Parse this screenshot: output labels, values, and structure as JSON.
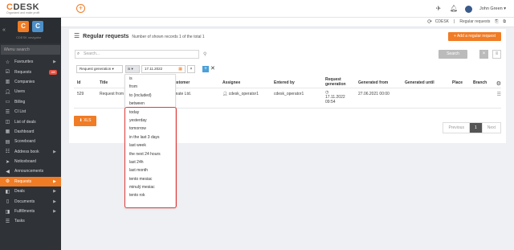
{
  "topbar": {
    "brand_c": "C",
    "brand_rest": "DESK",
    "tagline": "Organized and make profit",
    "add_symbol": "+",
    "user_name": "John Green"
  },
  "sidebar": {
    "logo1": "C",
    "logo2": "C",
    "sub": "CDESK navigator",
    "search_placeholder": "Menu search",
    "items": [
      {
        "label": "Favourites",
        "icon": "star-icon",
        "arrow": true
      },
      {
        "label": "Requests",
        "icon": "checkbox-icon",
        "badge": "169"
      },
      {
        "label": "Companies",
        "icon": "building-icon"
      },
      {
        "label": "Users",
        "icon": "user-icon"
      },
      {
        "label": "Billing",
        "icon": "card-icon"
      },
      {
        "label": "CI List",
        "icon": "list-icon"
      },
      {
        "label": "List of deals",
        "icon": "deal-icon"
      },
      {
        "label": "Dashboard",
        "icon": "dashboard-icon"
      },
      {
        "label": "Scoreboard",
        "icon": "chart-icon"
      },
      {
        "label": "Address book",
        "icon": "address-book-icon",
        "arrow": true
      },
      {
        "label": "Noticeboard",
        "icon": "pin-icon"
      },
      {
        "label": "Announcements",
        "icon": "megaphone-icon"
      },
      {
        "label": "Requests",
        "icon": "requests-icon",
        "arrow": true,
        "active": true
      },
      {
        "label": "Deals",
        "icon": "deals-icon",
        "arrow": true
      },
      {
        "label": "Documents",
        "icon": "documents-icon",
        "arrow": true
      },
      {
        "label": "Fulfillments",
        "icon": "fulfillments-icon",
        "arrow": true
      },
      {
        "label": "Tasks",
        "icon": "tasks-icon"
      }
    ]
  },
  "breadcrumb": {
    "items": [
      "CDESK",
      "Regular requests"
    ]
  },
  "panel": {
    "title": "Regular requests",
    "subtitle": "Number of shown records 1 of the total 1",
    "add_button": "+ Add a regular request",
    "search_placeholder": "Search...",
    "search_button": "Search",
    "clear_symbol": "×",
    "menu_symbol": "≡"
  },
  "filter": {
    "field": "Request generation ▾",
    "operator": "is ▾",
    "date": "17.11.2022",
    "remove": "×",
    "add": "+",
    "close": "✕"
  },
  "table": {
    "headers": {
      "id": "Id",
      "title": "Title",
      "customer": "Customer",
      "assignee": "Assignee",
      "entered_by": "Entered by",
      "request_generation_1": "Request",
      "request_generation_2": "generation",
      "generated_from": "Generated from",
      "generated_until": "Generated until",
      "place": "Place",
      "branch": "Branch"
    },
    "row": {
      "id": "529",
      "title": "Request from",
      "customer": "...mate Ltd.",
      "assignee": "cdesk_operator1",
      "entered_by": "cdesk_operator1",
      "generation_date": "17.11.2022",
      "generation_time": "09:54",
      "generated_from": "27.06.2021 00:00"
    }
  },
  "footer": {
    "xls_button": "XLS",
    "pager_prev": "Previous",
    "pager_current": "1",
    "pager_next": "Next"
  },
  "dropdown": {
    "options": [
      "is",
      "from",
      "to (included)",
      "between",
      "today",
      "yesterday",
      "tomorrow",
      "in the last 3 days",
      "last week",
      "the next 24 hours",
      "last 24h",
      "last month",
      "tento mesiac",
      "minulý mesiac",
      "tento rok"
    ]
  },
  "colors": {
    "accent": "#f07c25",
    "sidebar_bg": "#2f3237",
    "highlight": "#e03c3c"
  }
}
